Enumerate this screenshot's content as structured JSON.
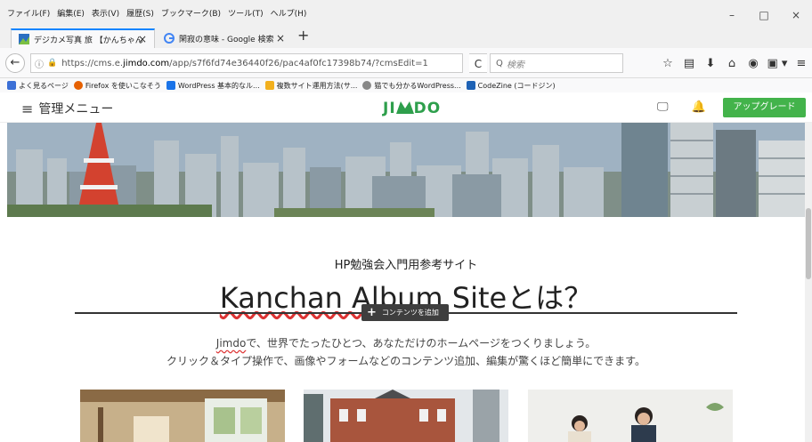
{
  "menubar": {
    "items": [
      "ファイル(F)",
      "編集(E)",
      "表示(V)",
      "履歴(S)",
      "ブックマーク(B)",
      "ツール(T)",
      "ヘルプ(H)"
    ]
  },
  "window_controls": {
    "minimize": "–",
    "maximize": "□",
    "close": "×"
  },
  "tabs": [
    {
      "label": "デジカメ写真 旅 【かんちゃん",
      "close": "×",
      "active": true
    },
    {
      "label": "閑寂の意味 - Google 検索",
      "close": "×",
      "active": false
    }
  ],
  "new_tab": "+",
  "navbar": {
    "back": "←",
    "info": "ⓘ",
    "lock": "🔒",
    "url_prefix": "https://cms.e.",
    "url_host": "jimdo.com",
    "url_suffix": "/app/s7f6fd74e36440f26/pac4af0fc17398b74/?cmsEdit=1",
    "reload": "C",
    "search_icon": "Q",
    "search_placeholder": "検索",
    "tool_icons": [
      "☆",
      "▤",
      "⬇",
      "⌂",
      "◉",
      "▣ ▾",
      "≡"
    ]
  },
  "bookmarks": [
    {
      "label": "よく見るページ",
      "color": "#3b6fd6"
    },
    {
      "label": "Firefox を使いこなそう",
      "color": "#e66000"
    },
    {
      "label": "WordPress 基本的なル...",
      "color": "#1a73e8"
    },
    {
      "label": "複数サイト運用方法(サ...",
      "color": "#f2b01e"
    },
    {
      "label": "猫でも分かるWordPress...",
      "color": "#888888"
    },
    {
      "label": "CodeZine (コードジン)",
      "color": "#1e62b5"
    }
  ],
  "jimdo_header": {
    "menu_icon": "≡",
    "menu_label": "管理メニュー",
    "logo_text_1": "JI",
    "logo_text_2": "DO",
    "monitor_icon": "🖵",
    "bell_icon": "🔔",
    "upgrade_label": "アップグレード"
  },
  "content": {
    "subtitle": "HP勉強会入門用参考サイト",
    "title_wavy": "Kanchan Album",
    "title_rest": " Siteとは？",
    "add_plus": "+",
    "add_label": "コンテンツを追加",
    "desc_line1_wavy": "Jimdo",
    "desc_line1_rest": "で、世界でたったひとつ、あなただけのホームページをつくりましょう。",
    "desc_line2": "クリック＆タイプ操作で、画像やフォームなどのコンテンツ追加、編集が驚くほど簡単にできます。"
  },
  "colors": {
    "accent_tab": "#0a84ff",
    "upgrade_green": "#43b34b",
    "jimdo_green": "#2e9f4c",
    "jimdo_blue": "#1f7de5"
  }
}
